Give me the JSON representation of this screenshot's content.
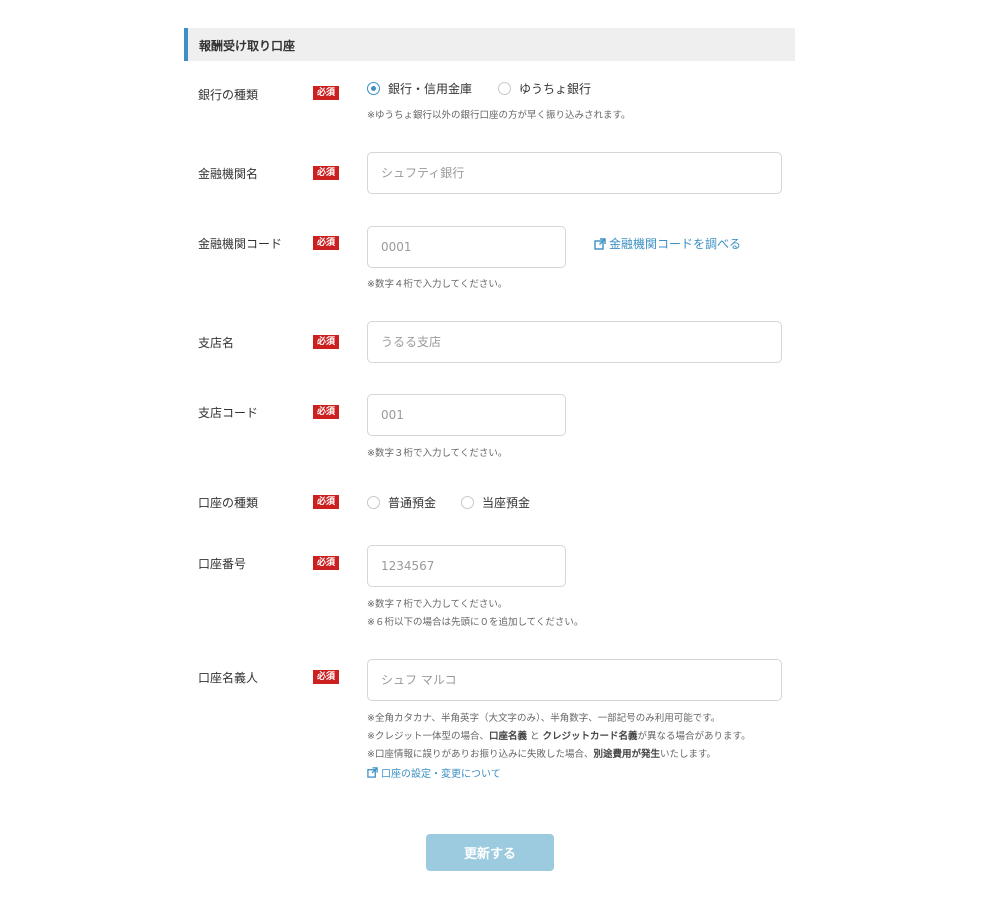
{
  "section": {
    "title": "報酬受け取り口座"
  },
  "required_label": "必須",
  "bank_type": {
    "label": "銀行の種類",
    "options": [
      "銀行・信用金庫",
      "ゆうちょ銀行"
    ],
    "selected": "銀行・信用金庫",
    "note": "※ゆうちょ銀行以外の銀行口座の方が早く振り込みされます。"
  },
  "bank_name": {
    "label": "金融機関名",
    "placeholder": "シュフティ銀行"
  },
  "bank_code": {
    "label": "金融機関コード",
    "placeholder": "0001",
    "lookup_link": "金融機関コードを調べる",
    "note": "※数字４桁で入力してください。"
  },
  "branch_name": {
    "label": "支店名",
    "placeholder": "うるる支店"
  },
  "branch_code": {
    "label": "支店コード",
    "placeholder": "001",
    "note": "※数字３桁で入力してください。"
  },
  "account_type": {
    "label": "口座の種類",
    "options": [
      "普通預金",
      "当座預金"
    ]
  },
  "account_number": {
    "label": "口座番号",
    "placeholder": "1234567",
    "notes": [
      "※数字７桁で入力してください。",
      "※６桁以下の場合は先頭に０を追加してください。"
    ]
  },
  "account_holder": {
    "label": "口座名義人",
    "placeholder": "シュフ マルコ",
    "note1": "※全角カタカナ、半角英字（大文字のみ）、半角数字、一部記号のみ利用可能です。",
    "note2_pre": "※クレジット一体型の場合、",
    "note2_b1": "口座名義",
    "note2_mid": " と ",
    "note2_b2": "クレジットカード名義",
    "note2_post": "が異なる場合があります。",
    "note3_pre": "※口座情報に誤りがありお振り込みに失敗した場合、",
    "note3_b": "別途費用が発生",
    "note3_post": "いたします。",
    "settings_link": "口座の設定・変更について"
  },
  "submit_label": "更新する",
  "colors": {
    "accent": "#3b8fc4",
    "required": "#cc1f1f",
    "submit": "#9ccbe0"
  }
}
